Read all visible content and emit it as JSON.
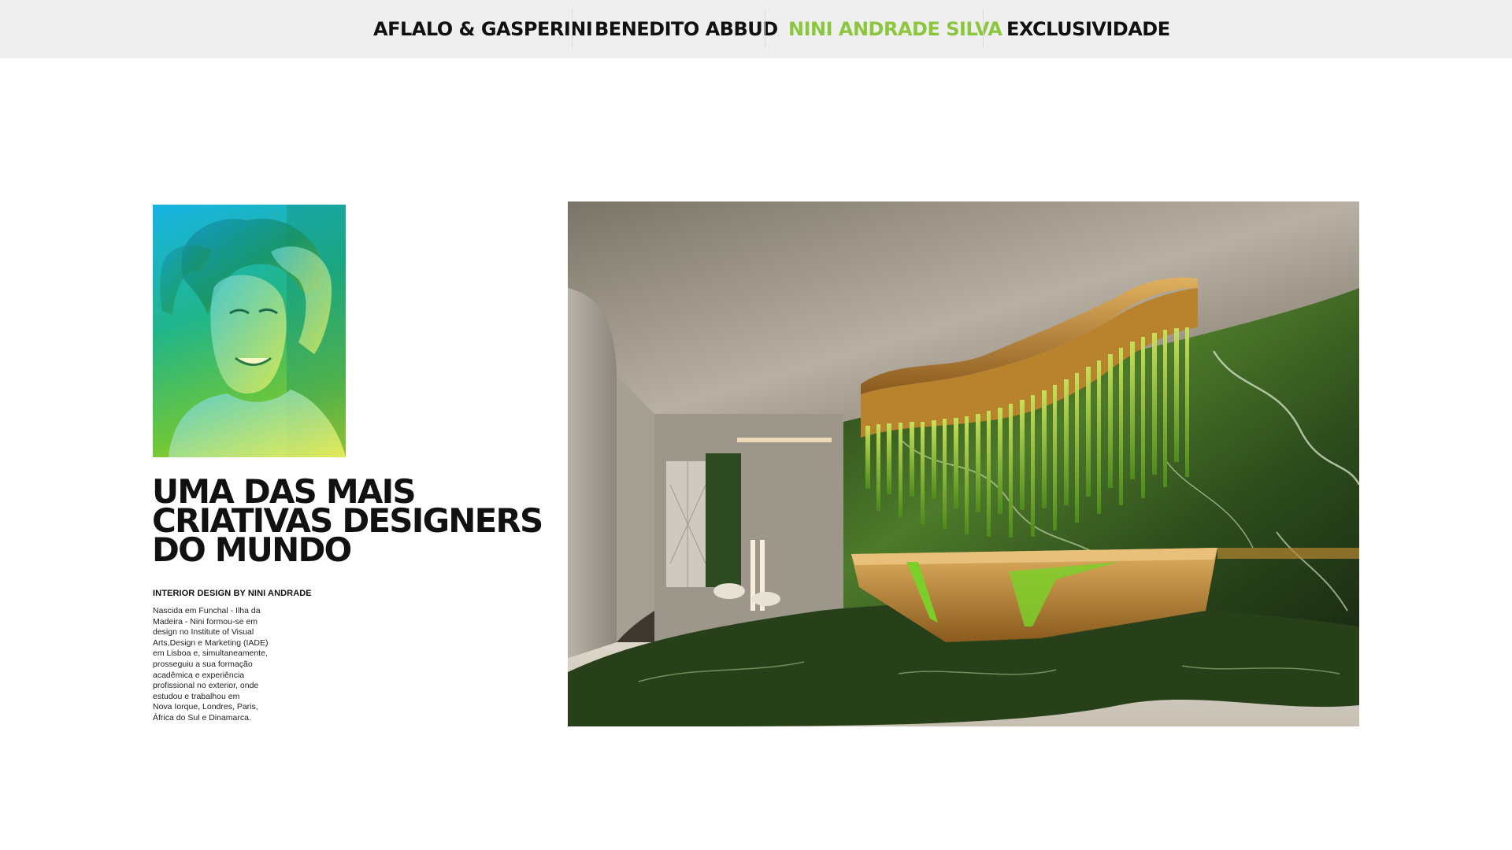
{
  "nav": {
    "items": [
      {
        "label": "AFLALO & GASPERINI",
        "active": false
      },
      {
        "label": "BENEDITO ABBUD",
        "active": false
      },
      {
        "label": "NINI ANDRADE SILVA",
        "active": true
      },
      {
        "label": "EXCLUSIVIDADE",
        "active": false
      }
    ],
    "active_color": "#8cc63f",
    "background": "#efefef"
  },
  "profile": {
    "portrait_gradient": [
      "#18b4e6",
      "#20b58a",
      "#6cc63a",
      "#d7dd10"
    ],
    "headline": "UMA DAS MAIS\nCRIATIVAS DESIGNERS\nDO MUNDO",
    "credit": "INTERIOR DESIGN BY NINI ANDRADE",
    "bio": "Nascida em Funchal - Ilha da\nMadeira - Nini formou-se em\ndesign no Institute of Visual\nArts,Design e Marketing (IADE)\nem Lisboa e, simultaneamente,\nprosseguiu a sua formação\nacadêmica e experiência\nprofissional no exterior, onde\nestudou e trabalhou em\nNova Iorque, Londres, Paris,\nÁfrica do Sul e Dinamarca."
  },
  "lobby_image": {
    "accent_colors": [
      "#c08a38",
      "#7fb42a",
      "#2a4a1e"
    ]
  }
}
